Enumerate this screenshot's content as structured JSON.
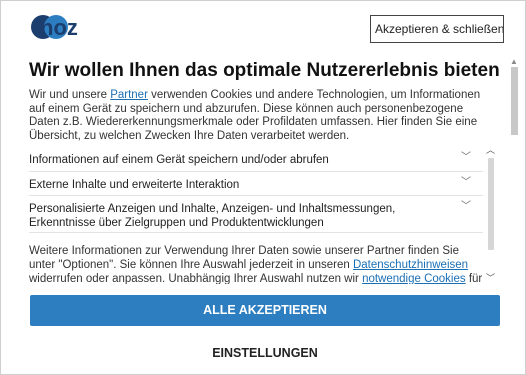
{
  "header": {
    "logo_text": "noz",
    "close_button_label": "Akzeptieren & schließen x"
  },
  "dialog": {
    "title": "Wir wollen Ihnen das optimale Nutzererlebnis bieten",
    "intro": {
      "before_link": "Wir und unsere ",
      "link_label": "Partner",
      "after_link": " verwenden Cookies und andere Technologien, um Informationen auf einem Gerät zu speichern und abzurufen. Diese können auch personenbezogene Daten z.B. Wiedererkennungsmerkmale oder Profildaten umfassen. Hier finden Sie eine Übersicht, zu welchen Zwecken Ihre Daten verarbeitet werden."
    },
    "accordion": [
      {
        "label": "Informationen auf einem Gerät speichern und/oder abrufen"
      },
      {
        "label": "Externe Inhalte und erweiterte Interaktion"
      },
      {
        "label": "Personalisierte Anzeigen und Inhalte, Anzeigen- und Inhaltsmessungen, Erkenntnisse über Zielgruppen und Produktentwicklungen"
      }
    ],
    "more_info": {
      "part1": "Weitere Informationen zur Verwendung Ihrer Daten sowie unserer Partner finden Sie unter \"Optionen\". Sie können Ihre Auswahl jederzeit in unseren ",
      "link1": "Datenschutzhinweisen",
      "part2": " widerrufen oder anpassen. Unabhängig Ihrer Auswahl nutzen wir ",
      "link2": "notwendige Cookies",
      "part3": " für den technischen"
    },
    "accept_all_label": "ALLE AKZEPTIEREN",
    "settings_label": "EINSTELLUNGEN"
  },
  "colors": {
    "accent": "#2c7ec1",
    "link": "#1a6fb5",
    "logo_dark": "#1c3e6e"
  }
}
